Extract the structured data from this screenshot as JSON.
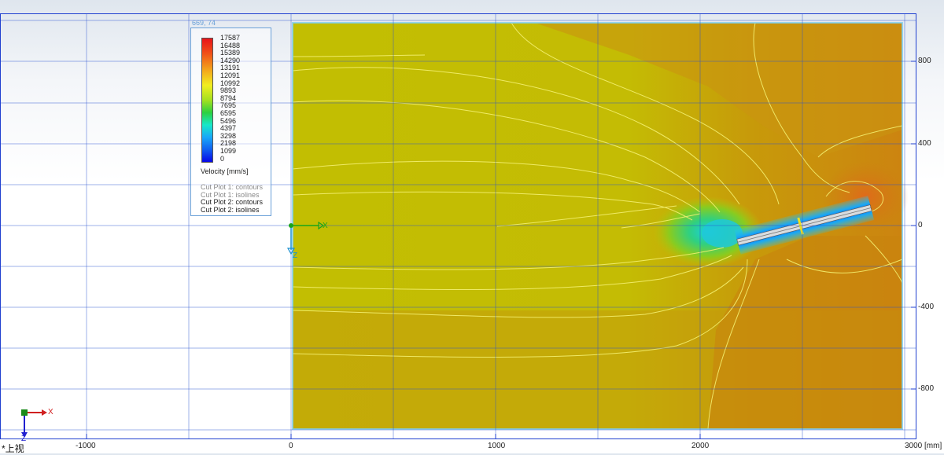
{
  "view": {
    "name": "*上视",
    "cursor_readout": "669, 74",
    "x_unit_label": "3000 [mm]",
    "origin_labels": {
      "x": "X",
      "z": "Z"
    },
    "triad_labels": {
      "x": "X",
      "z": "Z"
    }
  },
  "x_axis_ticks": [
    "-1000",
    "0",
    "1000",
    "2000"
  ],
  "y_axis_ticks": [
    "800",
    "400",
    "0",
    "-400",
    "-800"
  ],
  "legend": {
    "values": [
      "17587",
      "16488",
      "15389",
      "14290",
      "13191",
      "12091",
      "10992",
      "9893",
      "8794",
      "7695",
      "6595",
      "5496",
      "4397",
      "3298",
      "2198",
      "1099",
      "0"
    ],
    "quantity": "Velocity [mm/s]",
    "plots": [
      {
        "label": "Cut Plot 1: contours",
        "active": false
      },
      {
        "label": "Cut Plot 1: isolines",
        "active": false
      },
      {
        "label": "Cut Plot 2: contours",
        "active": true
      },
      {
        "label": "Cut Plot 2: isolines",
        "active": true
      }
    ]
  },
  "colors": {
    "field_base": "#c4c000",
    "field_warm": "#c8900a",
    "field_hot": "#cf7a14",
    "isoline": "#f4f070",
    "grid": "#2850d0",
    "axis_x": "#1aa51a",
    "axis_z": "#1a8fd0",
    "legend_border": "#6aa0d8"
  },
  "icons": [
    "coordinate-triad-icon",
    "origin-axis-icon"
  ]
}
